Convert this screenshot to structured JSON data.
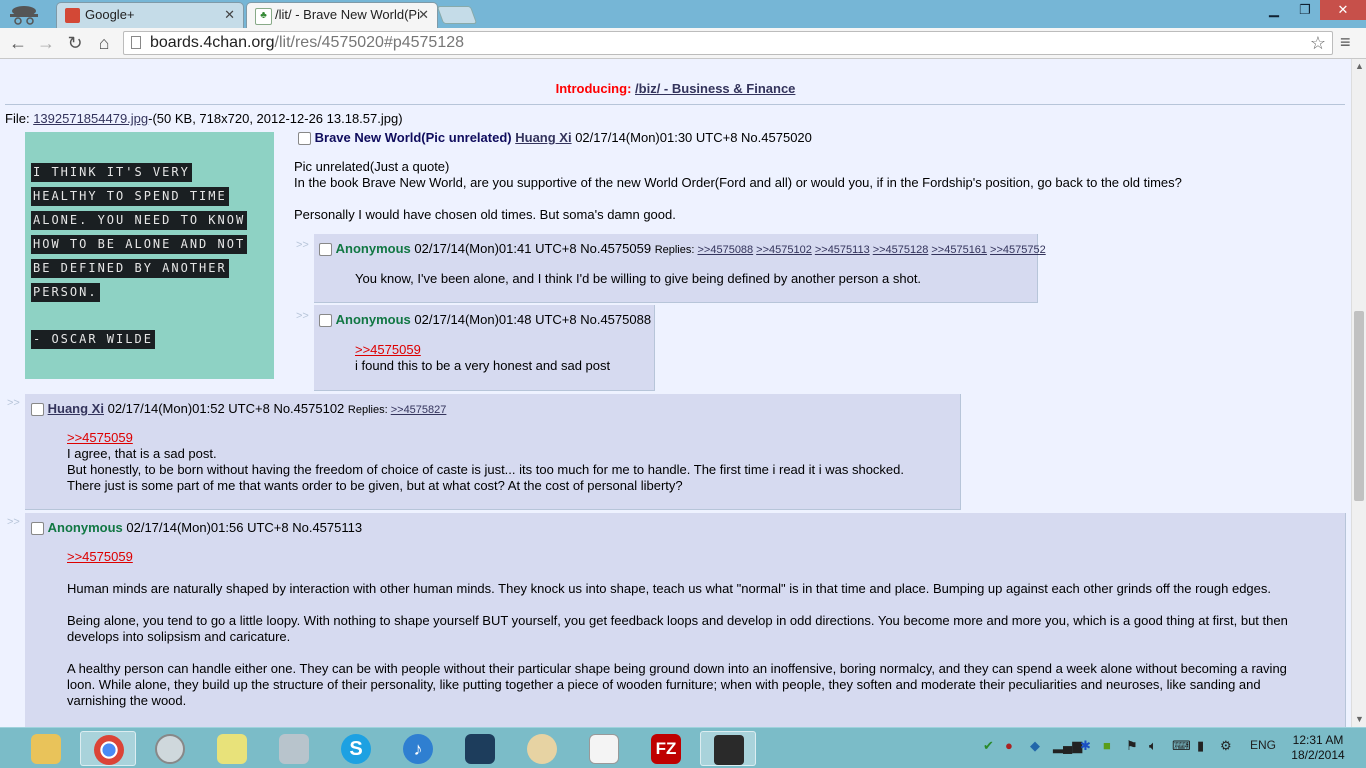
{
  "browser": {
    "tabs": [
      {
        "title": "Google+",
        "active": false
      },
      {
        "title": "/lit/ - Brave New World(Pi",
        "active": true
      }
    ],
    "url_host": "boards.4chan.org",
    "url_path": "/lit/res/4575020#p4575128",
    "icons": {
      "back": "back-arrow-icon",
      "forward": "forward-arrow-icon",
      "reload": "reload-icon",
      "home": "home-icon",
      "bookmark": "star-icon",
      "menu": "hamburger-menu-icon"
    }
  },
  "page": {
    "intro_label": "Introducing:",
    "intro_link": "/biz/ - Business & Finance",
    "file_prefix": "File:",
    "file_link": "1392571854479.jpg",
    "file_meta": "-(50 KB, 718x720, 2012-12-26 13.18.57.jpg)",
    "image_lines": [
      "I THINK IT'S VERY",
      "HEALTHY TO SPEND TIME",
      "ALONE. YOU NEED TO KNOW",
      "HOW TO BE ALONE AND NOT",
      "BE DEFINED BY ANOTHER",
      "PERSON.",
      "- OSCAR WILDE"
    ],
    "op": {
      "subject": "Brave New World(Pic unrelated)",
      "name": "Huang Xi",
      "datetime": "02/17/14(Mon)01:30 UTC+8 No.4575020",
      "lines": [
        "Pic unrelated(Just a quote)",
        "In the book Brave New World, are you supportive of the new World Order(Ford and all) or would you, if in the Fordship's position, go back to the old times?",
        "Personally I would have chosen old times. But soma's damn good."
      ]
    },
    "replies": [
      {
        "name": "Anonymous",
        "datetime": "02/17/14(Mon)01:41 UTC+8 No.4575059",
        "replies_label": "Replies:",
        "reply_links": [
          ">>4575088",
          ">>4575102",
          ">>4575113",
          ">>4575128",
          ">>4575161",
          ">>4575752"
        ],
        "lines": [
          "You know, I've been alone, and I think I'd be willing to give being defined by another person a shot."
        ]
      },
      {
        "name": "Anonymous",
        "datetime": "02/17/14(Mon)01:48 UTC+8 No.4575088",
        "quote": ">>4575059",
        "lines": [
          "i found this to be a very honest and sad post"
        ]
      },
      {
        "name": "Huang Xi",
        "datetime": "02/17/14(Mon)01:52 UTC+8 No.4575102",
        "replies_label": "Replies:",
        "reply_links": [
          ">>4575827"
        ],
        "quote": ">>4575059",
        "lines": [
          "I agree, that is a sad post.",
          "But honestly, to be born without having the freedom of choice of caste is just... its too much for me to handle. The first time i read it i was shocked.",
          "There just is some part of me that wants order to be given, but at what cost? At the cost of personal liberty?"
        ]
      },
      {
        "name": "Anonymous",
        "datetime": "02/17/14(Mon)01:56 UTC+8 No.4575113",
        "quote": ">>4575059",
        "lines": [
          "Human minds are naturally shaped by interaction with other human minds. They knock us into shape, teach us what \"normal\" is in that time and place. Bumping up against each other grinds off the rough edges.",
          "Being alone, you tend to go a little loopy. With nothing to shape yourself BUT yourself, you get feedback loops and develop in odd directions. You become more and more you, which is a good thing at first, but then",
          "develops into solipsism and caricature.",
          "A healthy person can handle either one. They can be with people without their particular shape being ground down into an inoffensive, boring normalcy, and they can spend a week alone without becoming a raving",
          "loon. While alone, they build up the structure of their personality, like putting together a piece of wooden furniture; when with people, they soften and moderate their peculiarities and neuroses, like sanding and",
          "varnishing the wood."
        ]
      }
    ]
  },
  "taskbar": {
    "apps": [
      "file-explorer-icon",
      "chrome-icon",
      "safari-icon",
      "sticky-notes-icon",
      "calculator-icon",
      "skype-icon",
      "itunes-icon",
      "mysql-workbench-icon",
      "paint-icon",
      "gnumeric-icon",
      "filezilla-icon",
      "steam-icon"
    ],
    "language": "ENG",
    "time": "12:31 AM",
    "date": "18/2/2014"
  },
  "colors": {
    "board_bg": "#eef2ff",
    "reply_bg": "#d6daf0",
    "name_green": "#117743",
    "subject_blue": "#0f0c5d",
    "quote_red": "#dd0000",
    "taskbar": "#7bbcc8"
  }
}
